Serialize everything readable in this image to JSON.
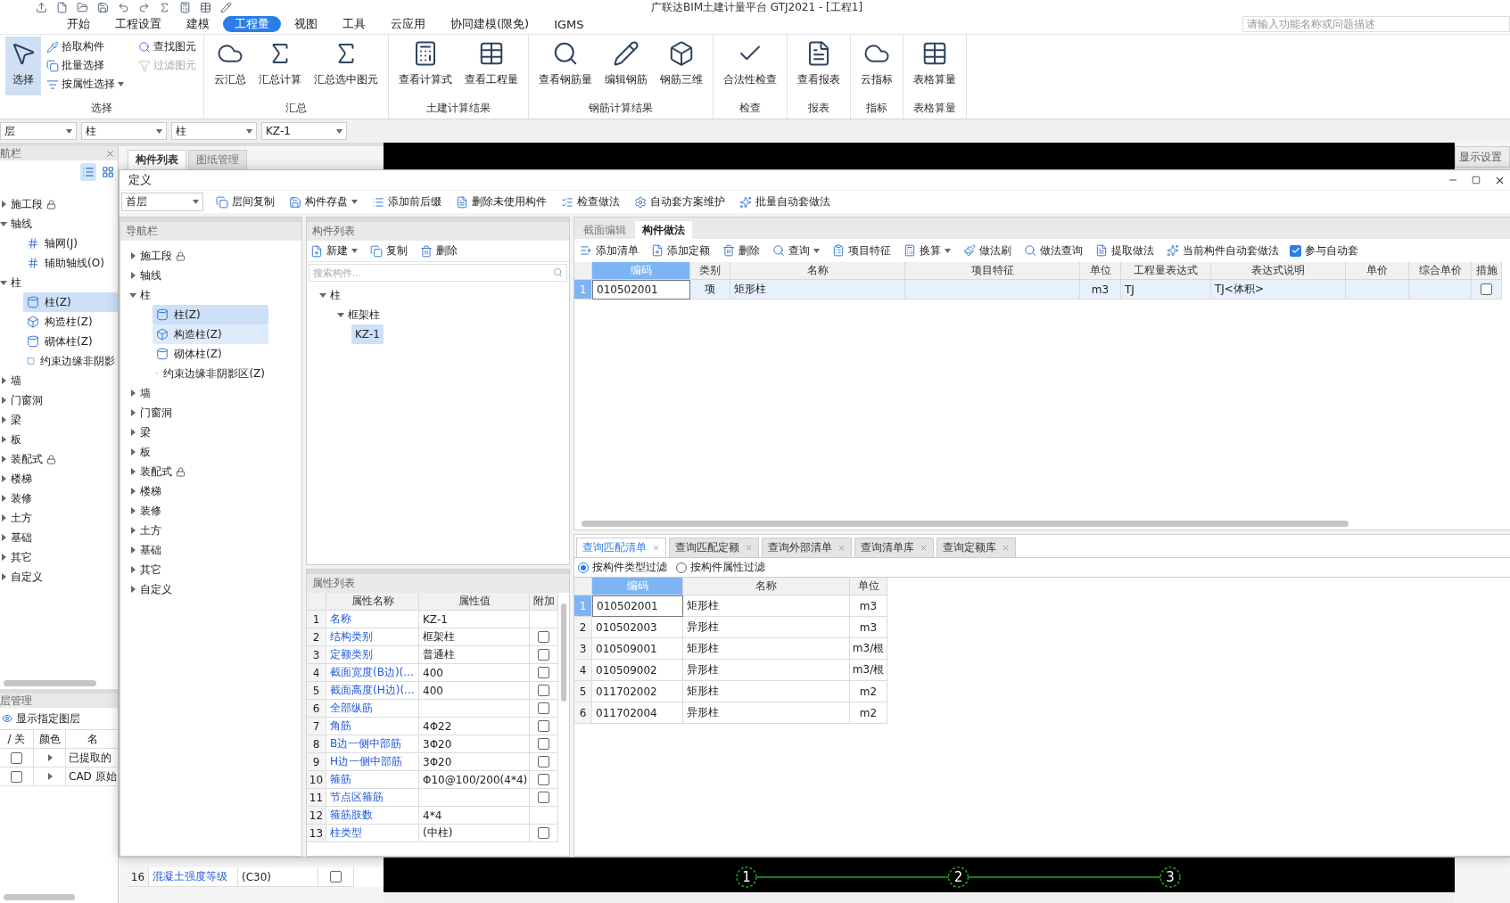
{
  "window": {
    "title": "广联达BIM土建计量平台 GTJ2021 - [工程1]"
  },
  "menu": [
    {
      "label": "开始",
      "selected": false
    },
    {
      "label": "工程设置",
      "selected": false
    },
    {
      "label": "建模",
      "selected": false
    },
    {
      "label": "工程量",
      "selected": true
    },
    {
      "label": "视图",
      "selected": false
    },
    {
      "label": "工具",
      "selected": false
    },
    {
      "label": "云应用",
      "selected": false
    },
    {
      "label": "协同建模(限免)",
      "selected": false
    },
    {
      "label": "IGMS",
      "selected": false
    }
  ],
  "search": {
    "placeholder": "请输入功能名称或问题描述"
  },
  "ribbon": [
    {
      "label": "选择",
      "tools": [
        {
          "label": "选择",
          "kind": "large",
          "selected": true,
          "disabled": false
        },
        {
          "label": "拾取构件",
          "kind": "small",
          "selected": false,
          "disabled": false
        },
        {
          "label": "批量选择",
          "kind": "small",
          "selected": false,
          "disabled": false
        },
        {
          "label": "按属性选择",
          "kind": "small-menu",
          "selected": false,
          "disabled": false
        },
        {
          "label": "查找图元",
          "kind": "small",
          "selected": false,
          "disabled": false
        },
        {
          "label": "过滤图元",
          "kind": "small",
          "selected": false,
          "disabled": true
        }
      ]
    },
    {
      "label": "汇总",
      "tools": [
        {
          "label": "云汇总",
          "kind": "large",
          "selected": false,
          "disabled": false
        },
        {
          "label": "汇总计算",
          "kind": "large",
          "selected": false,
          "disabled": false
        },
        {
          "label": "汇总选中图元",
          "kind": "large",
          "selected": false,
          "disabled": false
        }
      ]
    },
    {
      "label": "土建计算结果",
      "tools": [
        {
          "label": "查看计算式",
          "kind": "large",
          "selected": false,
          "disabled": false
        },
        {
          "label": "查看工程量",
          "kind": "large",
          "selected": false,
          "disabled": false
        }
      ]
    },
    {
      "label": "钢筋计算结果",
      "tools": [
        {
          "label": "查看钢筋量",
          "kind": "large",
          "selected": false,
          "disabled": false
        },
        {
          "label": "编辑钢筋",
          "kind": "large",
          "selected": false,
          "disabled": false
        },
        {
          "label": "钢筋三维",
          "kind": "large",
          "selected": false,
          "disabled": false
        }
      ]
    },
    {
      "label": "检查",
      "tools": [
        {
          "label": "合法性检查",
          "kind": "large",
          "selected": false,
          "disabled": false
        }
      ]
    },
    {
      "label": "报表",
      "tools": [
        {
          "label": "查看报表",
          "kind": "large",
          "selected": false,
          "disabled": false
        }
      ]
    },
    {
      "label": "指标",
      "tools": [
        {
          "label": "云指标",
          "kind": "large",
          "selected": false,
          "disabled": false
        }
      ]
    },
    {
      "label": "表格算量",
      "tools": [
        {
          "label": "表格算量",
          "kind": "large",
          "selected": false,
          "disabled": false
        }
      ]
    }
  ],
  "selectors": [
    "层",
    "柱",
    "柱",
    "KZ-1"
  ],
  "nav": {
    "title": "航栏",
    "tree": [
      {
        "label": "施工段",
        "expanded": false,
        "locked": true
      },
      {
        "label": "轴线",
        "expanded": true,
        "locked": false,
        "children": [
          {
            "label": "轴网(J)",
            "selected": false,
            "hover": false
          },
          {
            "label": "辅助轴线(O)",
            "selected": false,
            "hover": false
          }
        ]
      },
      {
        "label": "柱",
        "expanded": true,
        "locked": false,
        "children": [
          {
            "label": "柱(Z)",
            "selected": true,
            "hover": false
          },
          {
            "label": "构造柱(Z)",
            "selected": false,
            "hover": false
          },
          {
            "label": "砌体柱(Z)",
            "selected": false,
            "hover": false
          },
          {
            "label": "约束边缘非阴影",
            "selected": false,
            "hover": false
          }
        ]
      },
      {
        "label": "墙",
        "expanded": false,
        "locked": false
      },
      {
        "label": "门窗洞",
        "expanded": false,
        "locked": false
      },
      {
        "label": "梁",
        "expanded": false,
        "locked": false
      },
      {
        "label": "板",
        "expanded": false,
        "locked": false
      },
      {
        "label": "装配式",
        "expanded": false,
        "locked": true
      },
      {
        "label": "楼梯",
        "expanded": false,
        "locked": false
      },
      {
        "label": "装修",
        "expanded": false,
        "locked": false
      },
      {
        "label": "土方",
        "expanded": false,
        "locked": false
      },
      {
        "label": "基础",
        "expanded": false,
        "locked": false
      },
      {
        "label": "其它",
        "expanded": false,
        "locked": false
      },
      {
        "label": "自定义",
        "expanded": false,
        "locked": false
      }
    ]
  },
  "layers": {
    "title": "层管理",
    "action": "显示指定图层",
    "columns": [
      "/ 关",
      "颜色",
      "名"
    ],
    "rows": [
      {
        "on": false,
        "name": "已提取的"
      },
      {
        "on": false,
        "name": "CAD 原始"
      }
    ]
  },
  "panel_tabs": [
    {
      "label": "构件列表",
      "selected": true
    },
    {
      "label": "图纸管理",
      "selected": false
    }
  ],
  "hidden_property": {
    "index": "16",
    "name": "混凝土强度等级",
    "value": "(C30)",
    "checked": false
  },
  "side_tab": "显示设置",
  "axes": [
    "1",
    "2",
    "3"
  ],
  "dialog": {
    "title": "定义",
    "floor": "首层",
    "toolbar": [
      {
        "label": "层间复制",
        "kind": "button"
      },
      {
        "label": "构件存盘",
        "kind": "menu"
      },
      {
        "label": "添加前后缀",
        "kind": "button"
      },
      {
        "label": "删除未使用构件",
        "kind": "button"
      },
      {
        "label": "检查做法",
        "kind": "button"
      },
      {
        "label": "自动套方案维护",
        "kind": "button"
      },
      {
        "label": "批量自动套做法",
        "kind": "button"
      }
    ],
    "nav": {
      "title": "导航栏",
      "tree": [
        {
          "label": "施工段",
          "expanded": false,
          "locked": true
        },
        {
          "label": "轴线",
          "expanded": false,
          "locked": false
        },
        {
          "label": "柱",
          "expanded": true,
          "locked": false,
          "children": [
            {
              "label": "柱(Z)",
              "selected": true,
              "hover": false
            },
            {
              "label": "构造柱(Z)",
              "selected": false,
              "hover": true
            },
            {
              "label": "砌体柱(Z)",
              "selected": false,
              "hover": false
            },
            {
              "label": "约束边缘非阴影区(Z)",
              "selected": false,
              "hover": false
            }
          ]
        },
        {
          "label": "墙",
          "expanded": false,
          "locked": false
        },
        {
          "label": "门窗洞",
          "expanded": false,
          "locked": false
        },
        {
          "label": "梁",
          "expanded": false,
          "locked": false
        },
        {
          "label": "板",
          "expanded": false,
          "locked": false
        },
        {
          "label": "装配式",
          "expanded": false,
          "locked": true
        },
        {
          "label": "楼梯",
          "expanded": false,
          "locked": false
        },
        {
          "label": "装修",
          "expanded": false,
          "locked": false
        },
        {
          "label": "土方",
          "expanded": false,
          "locked": false
        },
        {
          "label": "基础",
          "expanded": false,
          "locked": false
        },
        {
          "label": "其它",
          "expanded": false,
          "locked": false
        },
        {
          "label": "自定义",
          "expanded": false,
          "locked": false
        }
      ]
    },
    "components": {
      "title": "构件列表",
      "toolbar": [
        {
          "label": "新建",
          "kind": "menu"
        },
        {
          "label": "复制",
          "kind": "button"
        },
        {
          "label": "删除",
          "kind": "button"
        }
      ],
      "search_placeholder": "搜索构件...",
      "tree": [
        {
          "label": "柱",
          "expanded": true,
          "children": [
            {
              "label": "框架柱",
              "expanded": true,
              "children": [
                {
                  "label": "KZ-1",
                  "selected": true
                }
              ]
            }
          ]
        }
      ]
    },
    "properties": {
      "title": "属性列表",
      "columns": [
        "属性名称",
        "属性值",
        "附加"
      ],
      "rows": [
        {
          "index": "1",
          "name": "名称",
          "value": "KZ-1",
          "kind": "plain"
        },
        {
          "index": "2",
          "name": "结构类别",
          "value": "框架柱",
          "kind": "check",
          "checked": false
        },
        {
          "index": "3",
          "name": "定额类别",
          "value": "普通柱",
          "kind": "check",
          "checked": false
        },
        {
          "index": "4",
          "name": "截面宽度(B边)(...",
          "value": "400",
          "kind": "check",
          "checked": false
        },
        {
          "index": "5",
          "name": "截面高度(H边)(...",
          "value": "400",
          "kind": "check",
          "checked": false
        },
        {
          "index": "6",
          "name": "全部纵筋",
          "kind": "check",
          "checked": false
        },
        {
          "index": "7",
          "name": "角筋",
          "value": "4Φ22",
          "kind": "check",
          "checked": false
        },
        {
          "index": "8",
          "name": "B边一侧中部筋",
          "value": "3Φ20",
          "kind": "check",
          "checked": false
        },
        {
          "index": "9",
          "name": "H边一侧中部筋",
          "value": "3Φ20",
          "kind": "check",
          "checked": false
        },
        {
          "index": "10",
          "name": "箍筋",
          "value": "Φ10@100/200(4*4)",
          "kind": "check",
          "checked": false
        },
        {
          "index": "11",
          "name": "节点区箍筋",
          "kind": "check",
          "checked": false
        },
        {
          "index": "12",
          "name": "箍筋肢数",
          "value": "4*4",
          "kind": "plain"
        },
        {
          "index": "13",
          "name": "柱类型",
          "value": "(中柱)",
          "kind": "check",
          "checked": false
        }
      ]
    },
    "method_tabs": [
      {
        "label": "截面编辑",
        "selected": false
      },
      {
        "label": "构件做法",
        "selected": true
      }
    ],
    "method_toolbar": [
      {
        "label": "添加清单",
        "kind": "button"
      },
      {
        "label": "添加定额",
        "kind": "button"
      },
      {
        "label": "删除",
        "kind": "button"
      },
      {
        "label": "查询",
        "kind": "menu"
      },
      {
        "label": "项目特征",
        "kind": "button"
      },
      {
        "label": "换算",
        "kind": "menu"
      },
      {
        "label": "做法刷",
        "kind": "button"
      },
      {
        "label": "做法查询",
        "kind": "button"
      },
      {
        "label": "提取做法",
        "kind": "button"
      },
      {
        "label": "当前构件自动套做法",
        "kind": "button"
      }
    ],
    "auto_apply": {
      "label": "参与自动套",
      "checked": true
    },
    "method_columns": [
      "编码",
      "类别",
      "名称",
      "项目特征",
      "单位",
      "工程量表达式",
      "表达式说明",
      "单价",
      "综合单价",
      "措施"
    ],
    "method_rows": [
      {
        "index": "1",
        "selected": true,
        "code": "010502001",
        "type": "项",
        "name": "矩形柱",
        "unit": "m3",
        "expr": "TJ",
        "desc": "TJ<体积>",
        "measure_checked": false
      }
    ],
    "query_tabs": [
      {
        "label": "查询匹配清单",
        "selected": true
      },
      {
        "label": "查询匹配定额",
        "selected": false
      },
      {
        "label": "查询外部清单",
        "selected": false
      },
      {
        "label": "查询清单库",
        "selected": false
      },
      {
        "label": "查询定额库",
        "selected": false
      }
    ],
    "filters": [
      {
        "label": "按构件类型过滤",
        "selected": true
      },
      {
        "label": "按构件属性过滤",
        "selected": false
      }
    ],
    "query_columns": [
      "编码",
      "名称",
      "单位"
    ],
    "query_rows": [
      {
        "index": "1",
        "code": "010502001",
        "name": "矩形柱",
        "unit": "m3",
        "selected": true
      },
      {
        "index": "2",
        "code": "010502003",
        "name": "异形柱",
        "unit": "m3",
        "selected": false
      },
      {
        "index": "3",
        "code": "010509001",
        "name": "矩形柱",
        "unit": "m3/根",
        "selected": false
      },
      {
        "index": "4",
        "code": "010509002",
        "name": "异形柱",
        "unit": "m3/根",
        "selected": false
      },
      {
        "index": "5",
        "code": "011702002",
        "name": "矩形柱",
        "unit": "m2",
        "selected": false
      },
      {
        "index": "6",
        "code": "011702004",
        "name": "异形柱",
        "unit": "m2",
        "selected": false
      }
    ]
  }
}
